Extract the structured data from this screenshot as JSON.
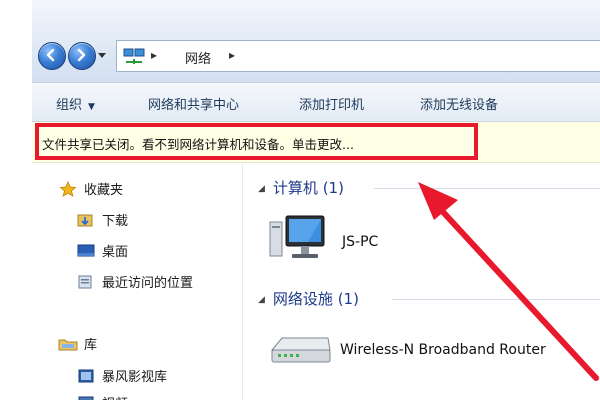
{
  "address": {
    "crumb": "网络"
  },
  "toolbar": {
    "organize": "组织",
    "network_center": "网络和共享中心",
    "add_printer": "添加打印机",
    "add_wireless": "添加无线设备"
  },
  "infobar": {
    "text": "文件共享已关闭。看不到网络计算机和设备。单击更改..."
  },
  "sidebar": {
    "items": [
      {
        "label": "收藏夹"
      },
      {
        "label": "下载"
      },
      {
        "label": "桌面"
      },
      {
        "label": "最近访问的位置"
      },
      {
        "label": "库"
      },
      {
        "label": "暴风影视库"
      },
      {
        "label": "视频"
      }
    ]
  },
  "groups": {
    "computers": {
      "label": "计算机 (1)",
      "items": [
        {
          "label": "JS-PC"
        }
      ]
    },
    "infrastructure": {
      "label": "网络设施 (1)",
      "items": [
        {
          "label": "Wireless-N Broadband Router"
        }
      ]
    }
  },
  "colors": {
    "highlight": "#e8192c",
    "arrow": "#e8192c",
    "group_heading": "#1e3a8a"
  }
}
